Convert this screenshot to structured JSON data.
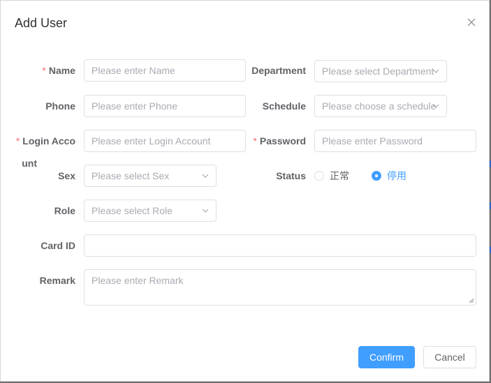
{
  "dialog": {
    "title": "Add User",
    "close_icon": "close-icon"
  },
  "form": {
    "name": {
      "label": "Name",
      "required": "*",
      "placeholder": "Please enter Name"
    },
    "department": {
      "label": "Department",
      "placeholder": "Please select Department"
    },
    "phone": {
      "label": "Phone",
      "placeholder": "Please enter Phone"
    },
    "schedule": {
      "label": "Schedule",
      "placeholder": "Please choose a schedule"
    },
    "login_account": {
      "label_line1": "Login Acco",
      "label_line2": "unt",
      "required": "*",
      "placeholder": "Please enter Login Account"
    },
    "password": {
      "label": "Password",
      "required": "*",
      "placeholder": "Please enter Password"
    },
    "sex": {
      "label": "Sex",
      "placeholder": "Please select Sex"
    },
    "status": {
      "label": "Status",
      "options": [
        "正常",
        "停用"
      ],
      "selected": "停用"
    },
    "role": {
      "label": "Role",
      "placeholder": "Please select Role"
    },
    "card_id": {
      "label": "Card ID",
      "value": ""
    },
    "remark": {
      "label": "Remark",
      "placeholder": "Please enter Remark"
    }
  },
  "footer": {
    "confirm_label": "Confirm",
    "cancel_label": "Cancel"
  },
  "colors": {
    "primary": "#409eff",
    "required": "#f56c6c",
    "border": "#dcdfe6",
    "placeholder": "#a8abb2"
  }
}
